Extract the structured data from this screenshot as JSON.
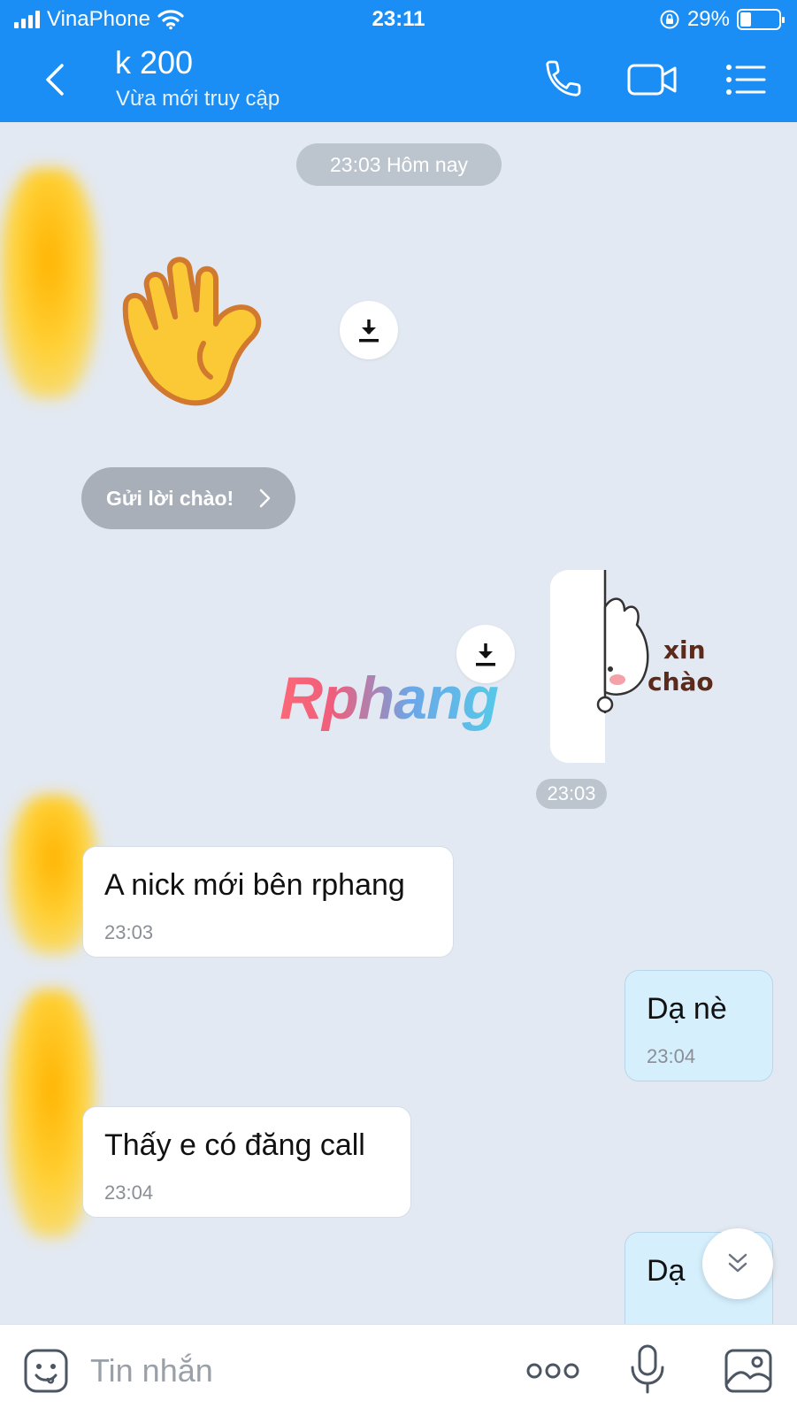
{
  "status_bar": {
    "carrier": "VinaPhone",
    "time": "23:11",
    "battery": "29%",
    "battery_level": 0.29
  },
  "header": {
    "title": "k 200",
    "subtitle": "Vừa mới truy cập"
  },
  "chat": {
    "date_label": "23:03 Hôm nay",
    "greet_button": "Gửi lời chào!",
    "sticker_text_line1": "xin",
    "sticker_text_line2": "chào",
    "watermark": "Rphang",
    "time_label": "23:03",
    "messages": [
      {
        "direction": "in",
        "text": "A nick mới bên rphang",
        "time": "23:03"
      },
      {
        "direction": "out",
        "text": "Dạ nè",
        "time": "23:04"
      },
      {
        "direction": "in",
        "text": "Thấy e có đăng call",
        "time": "23:04"
      },
      {
        "direction": "out",
        "text": "Dạ",
        "time": ""
      }
    ]
  },
  "input": {
    "placeholder": "Tin nhắn"
  },
  "colors": {
    "header_blue": "#1a8ef5",
    "chat_background": "#e3e9f2",
    "outgoing_bubble": "#d5effd"
  },
  "icons": [
    "signal-icon",
    "wifi-icon",
    "rotation-lock-icon",
    "battery-icon",
    "back-icon",
    "phone-icon",
    "video-icon",
    "menu-icon",
    "download-icon",
    "wave-hand-icon",
    "chevron-right-icon",
    "chevron-double-down-icon",
    "emoji-icon",
    "more-icon",
    "mic-icon",
    "image-icon"
  ]
}
